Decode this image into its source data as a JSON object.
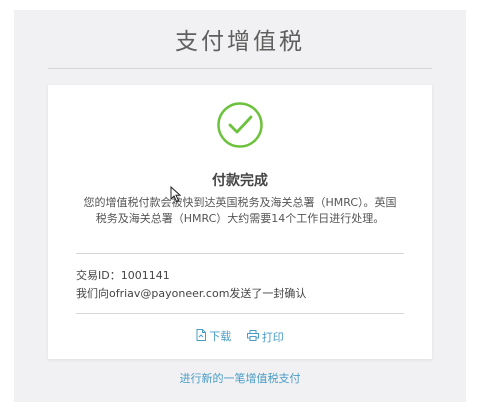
{
  "page": {
    "title": "支付增值税",
    "new_payment_link": "进行新的一笔增值税支付"
  },
  "card": {
    "status_icon": "check-circle-icon",
    "heading": "付款完成",
    "message_line1": "您的增值税付款会被快到达英国税务及海关总署（HMRC）。英国",
    "message_line2": "税务及海关总署（HMRC）大约需要14个工作日进行处理。",
    "transaction_label": "交易ID：",
    "transaction_id": "1001141",
    "confirmation_prefix": "我们向",
    "confirmation_email": "ofriav@payoneer.com",
    "confirmation_suffix": "发送了一封确认",
    "download_label": "下载",
    "print_label": "打印"
  },
  "colors": {
    "accent_green": "#6dc23d",
    "link_blue": "#4a9dc7",
    "background": "#f1f1f3"
  }
}
